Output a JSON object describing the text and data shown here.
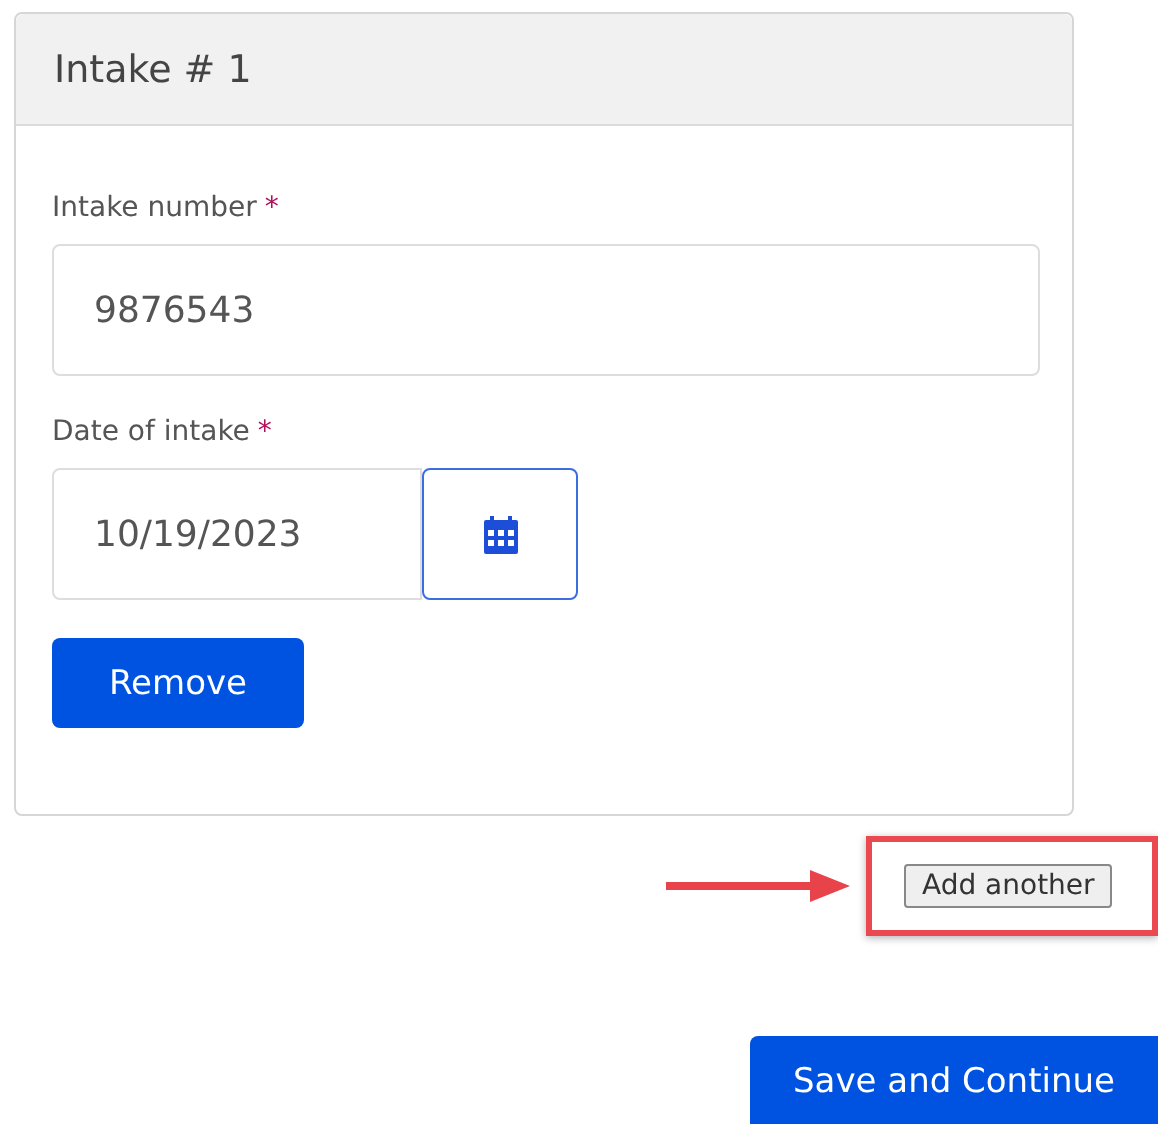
{
  "card": {
    "title": "Intake # 1",
    "fields": [
      {
        "kind": "text",
        "label": "Intake number",
        "required_mark": "*",
        "value": "9876543"
      },
      {
        "kind": "date",
        "label": "Date of intake",
        "required_mark": "*",
        "value": "10/19/2023"
      }
    ],
    "remove_button": "Remove"
  },
  "add_another_button": "Add another",
  "save_button": "Save and Continue"
}
